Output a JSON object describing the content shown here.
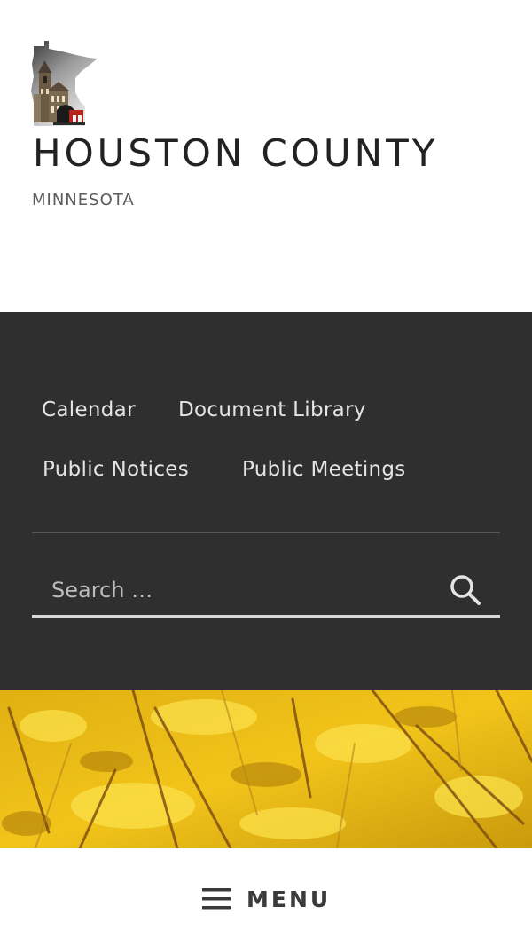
{
  "site": {
    "title": "HOUSTON COUNTY",
    "tagline": "MINNESOTA"
  },
  "nav": {
    "items": [
      {
        "label": "Calendar"
      },
      {
        "label": "Document Library"
      },
      {
        "label": "Public Notices"
      },
      {
        "label": "Public Meetings"
      }
    ]
  },
  "search": {
    "placeholder": "Search …"
  },
  "menu": {
    "label": "MENU"
  },
  "icons": {
    "logo": "minnesota-courthouse-logo",
    "search": "search-icon",
    "menu": "hamburger-icon"
  },
  "colors": {
    "panel_background": "#2f2f2f",
    "nav_text": "#e4e4e4",
    "title_text": "#222222",
    "hero_gold": "#d8a510"
  }
}
